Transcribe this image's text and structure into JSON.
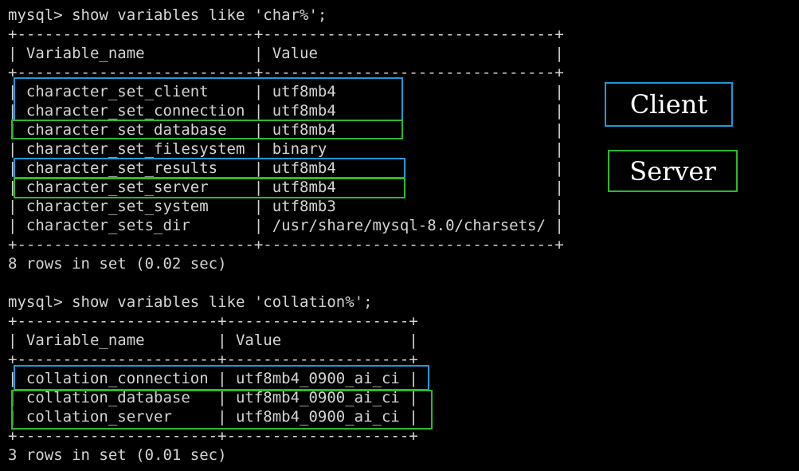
{
  "terminal": {
    "lines": [
      "mysql> show variables like 'char%';",
      "+--------------------------+--------------------------------+",
      "| Variable_name            | Value                          |",
      "+--------------------------+--------------------------------+",
      "| character_set_client     | utf8mb4                        |",
      "| character_set_connection | utf8mb4                        |",
      "| character_set_database   | utf8mb4                        |",
      "| character_set_filesystem | binary                         |",
      "| character_set_results    | utf8mb4                        |",
      "| character_set_server     | utf8mb4                        |",
      "| character_set_system     | utf8mb3                        |",
      "| character_sets_dir       | /usr/share/mysql-8.0/charsets/ |",
      "+--------------------------+--------------------------------+",
      "8 rows in set (0.02 sec)",
      "",
      "mysql> show variables like 'collation%';",
      "+----------------------+--------------------+",
      "| Variable_name        | Value              |",
      "+----------------------+--------------------+",
      "| collation_connection | utf8mb4_0900_ai_ci |",
      "| collation_database   | utf8mb4_0900_ai_ci |",
      "| collation_server     | utf8mb4_0900_ai_ci |",
      "+----------------------+--------------------+",
      "3 rows in set (0.01 sec)"
    ]
  },
  "annotations": {
    "client_label": "Client",
    "server_label": "Server",
    "client_color": "#1e9bd7",
    "server_color": "#2eb82e"
  }
}
